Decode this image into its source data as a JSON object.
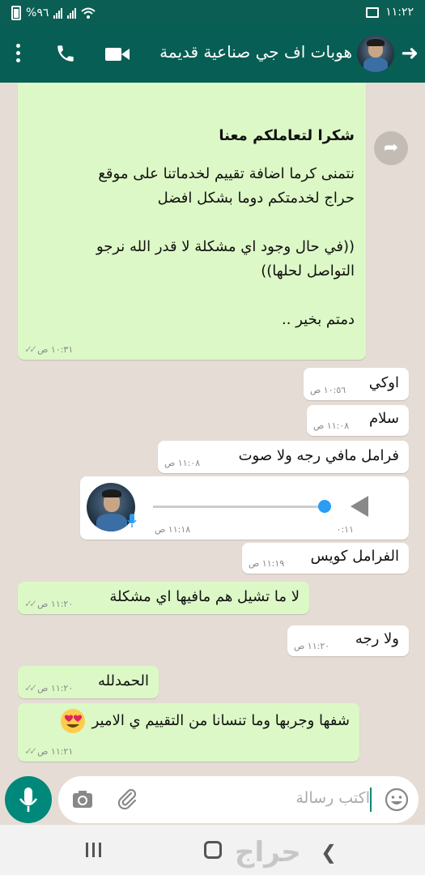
{
  "status_bar": {
    "time": "١١:٢٢",
    "battery": "%٩٦"
  },
  "header": {
    "title": "هوبات اف جي صناعية قديمة",
    "icons": [
      "back-arrow-icon",
      "avatar",
      "video-call-icon",
      "phone-icon",
      "more-icon"
    ]
  },
  "messages": [
    {
      "direction": "out",
      "title": "شكرا لتعاملكم معنا",
      "body": "نتمنى كرما اضافة تقييم لخدماتنا على موقع\nحراج لخدمتكم دوما بشكل افضل\n\n((في حال وجود اي مشكلة لا قدر الله نرجو\nالتواصل لحلها))\n\nدمتم بخير ..",
      "time": "١٠:٣١ ص"
    },
    {
      "direction": "in",
      "text": "اوكي",
      "time": "١٠:٥٦ ص"
    },
    {
      "direction": "in",
      "text": "سلام",
      "time": "١١:٠٨ ص"
    },
    {
      "direction": "in",
      "text": "فرامل مافي رجه ولا صوت",
      "time": "١١:٠٨ ص"
    },
    {
      "direction": "in",
      "type": "voice",
      "duration": "٠:١١",
      "time": "١١:١٨ ص",
      "progress": 1.0
    },
    {
      "direction": "in",
      "text": "الفرامل كويس",
      "time": "١١:١٩ ص"
    },
    {
      "direction": "out",
      "text": "لا ما تشيل هم مافيها اي مشكلة",
      "time": "١١:٢٠ ص"
    },
    {
      "direction": "in",
      "text": "ولا رجه",
      "time": "١١:٢٠ ص"
    },
    {
      "direction": "out",
      "text": "الحمدلله",
      "time": "١١:٢٠ ص"
    },
    {
      "direction": "out",
      "text": "شفها وجربها وما تنسانا من التقييم ي الامير",
      "time": "١١:٢١ ص",
      "emoji": "heart-eyes-emoji"
    }
  ],
  "composer": {
    "placeholder": "اكتب رسالة"
  },
  "watermark": "حراج",
  "colors": {
    "header": "#075e54",
    "outgoing_bubble": "#dcf8c6",
    "incoming_bubble": "#ffffff",
    "chat_background": "#e5ddd5",
    "accent": "#00897b"
  }
}
